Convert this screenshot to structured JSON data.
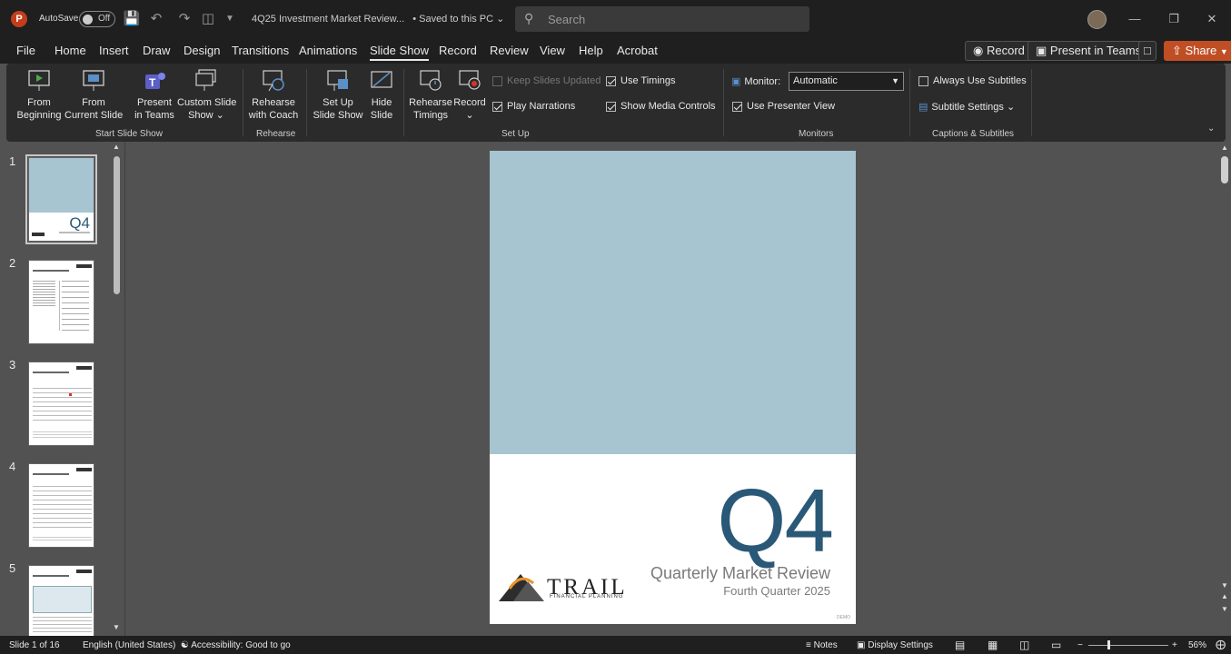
{
  "titlebar": {
    "autosave_label": "AutoSave",
    "autosave_state": "Off",
    "doc_title": "4Q25 Investment Market Review...",
    "saved_status": "• Saved to this PC ⌄",
    "search_placeholder": "Search"
  },
  "tabs": [
    "File",
    "Home",
    "Insert",
    "Draw",
    "Design",
    "Transitions",
    "Animations",
    "Slide Show",
    "Record",
    "Review",
    "View",
    "Help",
    "Acrobat"
  ],
  "active_tab": "Slide Show",
  "header_buttons": {
    "record": "Record",
    "present_in_teams": "Present in Teams",
    "share": "Share"
  },
  "ribbon": {
    "start_slide_show": {
      "label": "Start Slide Show",
      "from_beginning": [
        "From",
        "Beginning"
      ],
      "from_current": [
        "From",
        "Current Slide"
      ],
      "present_teams": [
        "Present",
        "in Teams"
      ],
      "custom": [
        "Custom Slide",
        "Show ⌄"
      ]
    },
    "rehearse": {
      "label": "Rehearse",
      "with_coach": [
        "Rehearse",
        "with Coach"
      ]
    },
    "setup": {
      "label": "Set Up",
      "setup_show": [
        "Set Up",
        "Slide Show"
      ],
      "hide_slide": [
        "Hide",
        "Slide"
      ],
      "rehearse_timings": [
        "Rehearse",
        "Timings"
      ],
      "record": [
        "Record",
        "⌄"
      ],
      "keep_updated": "Keep Slides Updated",
      "play_narrations": "Play Narrations",
      "use_timings": "Use Timings",
      "show_media": "Show Media Controls"
    },
    "monitors": {
      "label": "Monitors",
      "monitor_label": "Monitor:",
      "monitor_value": "Automatic",
      "presenter_view": "Use Presenter View"
    },
    "captions": {
      "label": "Captions & Subtitles",
      "always_subtitles": "Always Use Subtitles",
      "subtitle_settings": "Subtitle Settings ⌄"
    }
  },
  "slides": [
    {
      "num": "1",
      "title": "Q4"
    },
    {
      "num": "2",
      "title": "Quarterly Market Review"
    },
    {
      "num": "3",
      "title": "Quarterly Market Summary"
    },
    {
      "num": "4",
      "title": "Long-Term Market Summary"
    },
    {
      "num": "5",
      "title": "World Stock Market Performance"
    }
  ],
  "current_slide": {
    "big": "Q4",
    "title": "Quarterly Market Review",
    "subtitle": "Fourth Quarter 2025",
    "logo_name": "TRAIL",
    "logo_sub": "FINANCIAL PLANNING",
    "footnote": "DEMO"
  },
  "status": {
    "slide_count": "Slide 1 of 16",
    "language": "English (United States)",
    "accessibility": "Accessibility: Good to go",
    "notes": "Notes",
    "display_settings": "Display Settings",
    "zoom": "56%"
  },
  "colors": {
    "accent_band": "#a7c4d1",
    "q4_blue": "#2a5877",
    "share_orange": "#c04e24"
  }
}
